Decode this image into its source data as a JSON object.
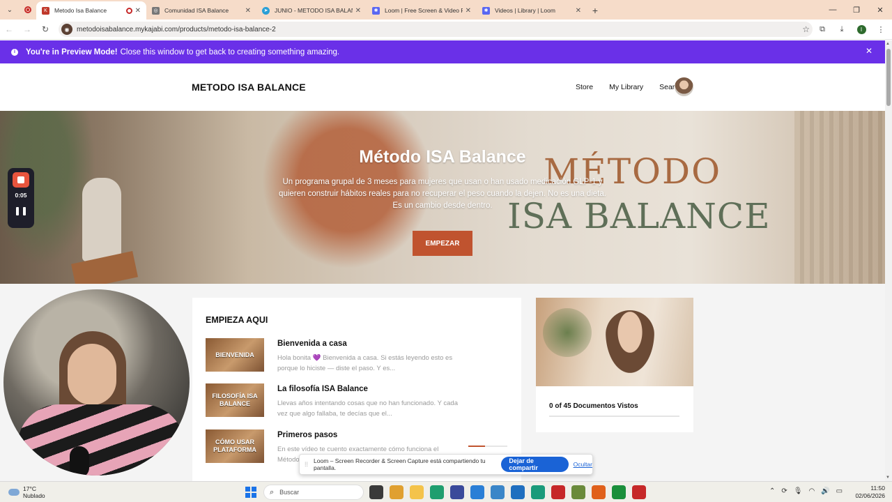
{
  "browser": {
    "tabs": [
      {
        "title": "Metodo Isa Balance",
        "active": true,
        "favicon_color": "#c0392b",
        "favicon_glyph": "K"
      },
      {
        "title": "Comunidad ISA Balance",
        "active": false,
        "favicon_color": "#777777",
        "favicon_glyph": "◎"
      },
      {
        "title": "JUNIO - METODO ISA BALANCE",
        "active": false,
        "favicon_color": "#2a9fd6",
        "favicon_glyph": "➤"
      },
      {
        "title": "Loom | Free Screen & Video Re",
        "active": false,
        "favicon_color": "#5a67f2",
        "favicon_glyph": "✱"
      },
      {
        "title": "Videos | Library | Loom",
        "active": false,
        "favicon_color": "#5a67f2",
        "favicon_glyph": "✱"
      }
    ],
    "url": "metodoisabalance.mykajabi.com/products/metodo-isa-balance-2",
    "profile_initial": "I"
  },
  "preview_banner": {
    "bold": "You're in Preview Mode!",
    "text": "Close this window to get back to creating something amazing."
  },
  "site": {
    "brand": "METODO ISA BALANCE",
    "nav": [
      "Store",
      "My Library",
      "Search"
    ]
  },
  "hero": {
    "title": "Método ISA Balance",
    "subtitle": "Un programa grupal de 3 meses para mujeres que usan o han usado medicación GLP-1 y quieren construir hábitos reales para no recuperar el peso cuando la dejen. No es una dieta. Es un cambio desde dentro.",
    "logo_line1": "MÉTODO",
    "logo_line2": "ISA BALANCE",
    "button": "EMPEZAR"
  },
  "course": {
    "heading": "EMPIEZA AQUI",
    "lessons": [
      {
        "thumb": "BIENVENIDA",
        "title": "Bienvenida a casa",
        "desc": "Hola bonita 💜 Bienvenida a casa. Si estás leyendo esto es porque lo hiciste — diste el paso. Y es..."
      },
      {
        "thumb": "FILOSOFÍA ISA BALANCE",
        "title": "La filosofía ISA Balance",
        "desc": "Llevas años intentando cosas que no han funcionado. Y cada vez que algo fallaba, te decías que el..."
      },
      {
        "thumb": "CÓMO USAR PLATAFORMA",
        "title": "Primeros pasos",
        "desc": "En este vídeo te cuento exactamente cómo funciona el Método..."
      }
    ],
    "docs_viewed": "0 of 45 Documentos Vistos"
  },
  "loom": {
    "timer": "0:05",
    "share_text": "Loom – Screen Recorder & Screen Capture está compartiendo tu pantalla.",
    "stop_share": "Dejar de compartir",
    "hide": "Ocultar"
  },
  "taskbar": {
    "temp": "17°C",
    "weather": "Nublado",
    "search": "Buscar",
    "time": "11:50",
    "date": "02/06/2026",
    "app_colors": [
      "#3a3a3a",
      "#e0a030",
      "#f4c34a",
      "#1f9e6e",
      "#3a4a9a",
      "#2a7fd6",
      "#3a86c8",
      "#1f6fbf",
      "#1a9b7a",
      "#c62828",
      "#6a8a3a",
      "#e0601a",
      "#1a8f3a",
      "#c62828"
    ]
  }
}
